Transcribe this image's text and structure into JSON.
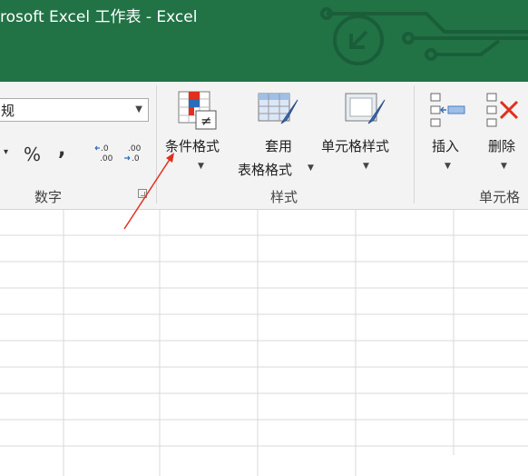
{
  "titlebar": {
    "title": "rosoft Excel 工作表  -  Excel"
  },
  "number_group": {
    "format_value": "规",
    "percent": "%",
    "comma": ",",
    "dec_inc": "←.0\n.00",
    "dec_dec": ".00\n→.0",
    "label": "数字"
  },
  "styles_group": {
    "conditional_format": "条件格式",
    "table_format_line1": "套用",
    "table_format_line2": "表格格式",
    "cell_styles": "单元格样式",
    "label": "样式"
  },
  "cells_group": {
    "insert": "插入",
    "delete": "删除",
    "label": "单元格"
  },
  "colors": {
    "title_green": "#217346",
    "ribbon_bg": "#f3f3f3",
    "arrow_red": "#e0301e"
  }
}
